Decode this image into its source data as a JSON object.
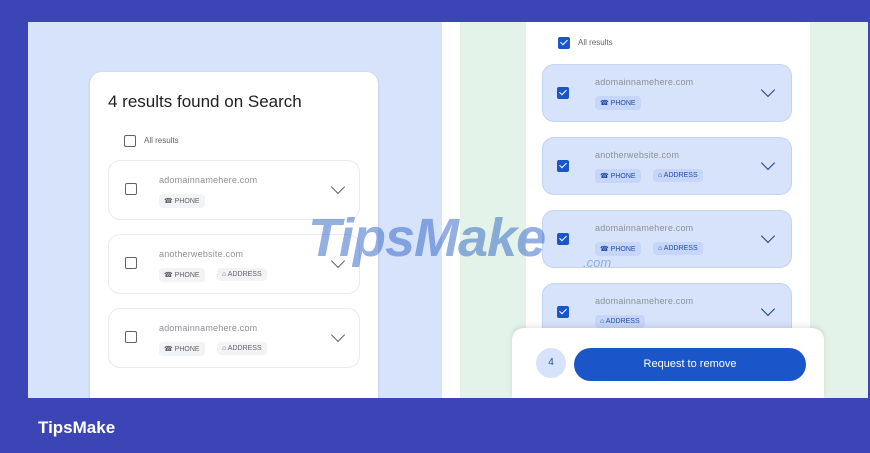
{
  "left_card": {
    "title": "4 results found on Search",
    "all_results_label": "All results",
    "rows": [
      {
        "domain": "adomainnamehere.com",
        "chips": [
          "☎ PHONE"
        ]
      },
      {
        "domain": "anotherwebsite.com",
        "chips": [
          "☎ PHONE",
          "⌂ ADDRESS"
        ]
      },
      {
        "domain": "adomainnamehere.com",
        "chips": [
          "☎ PHONE",
          "⌂ ADDRESS"
        ]
      }
    ]
  },
  "right_card": {
    "all_results_label": "All results",
    "rows": [
      {
        "domain": "adomainnamehere.com",
        "chips": [
          "☎ PHONE"
        ]
      },
      {
        "domain": "anotherwebsite.com",
        "chips": [
          "☎ PHONE",
          "⌂ ADDRESS"
        ]
      },
      {
        "domain": "adomainnamehere.com",
        "chips": [
          "☎ PHONE",
          "⌂ ADDRESS"
        ]
      },
      {
        "domain": "adomainnamehere.com",
        "chips": [
          "⌂ ADDRESS"
        ]
      }
    ],
    "count": "4",
    "remove_button": "Request to remove"
  },
  "watermark": {
    "text": "TipsMake",
    "suffix": ".com"
  },
  "footer": {
    "brand": "TipsMake"
  },
  "colors": {
    "accent": "#1a56c8",
    "frame": "#3b45b5",
    "left_bg": "#d7e3fb",
    "right_bg": "#e4f3e9"
  }
}
